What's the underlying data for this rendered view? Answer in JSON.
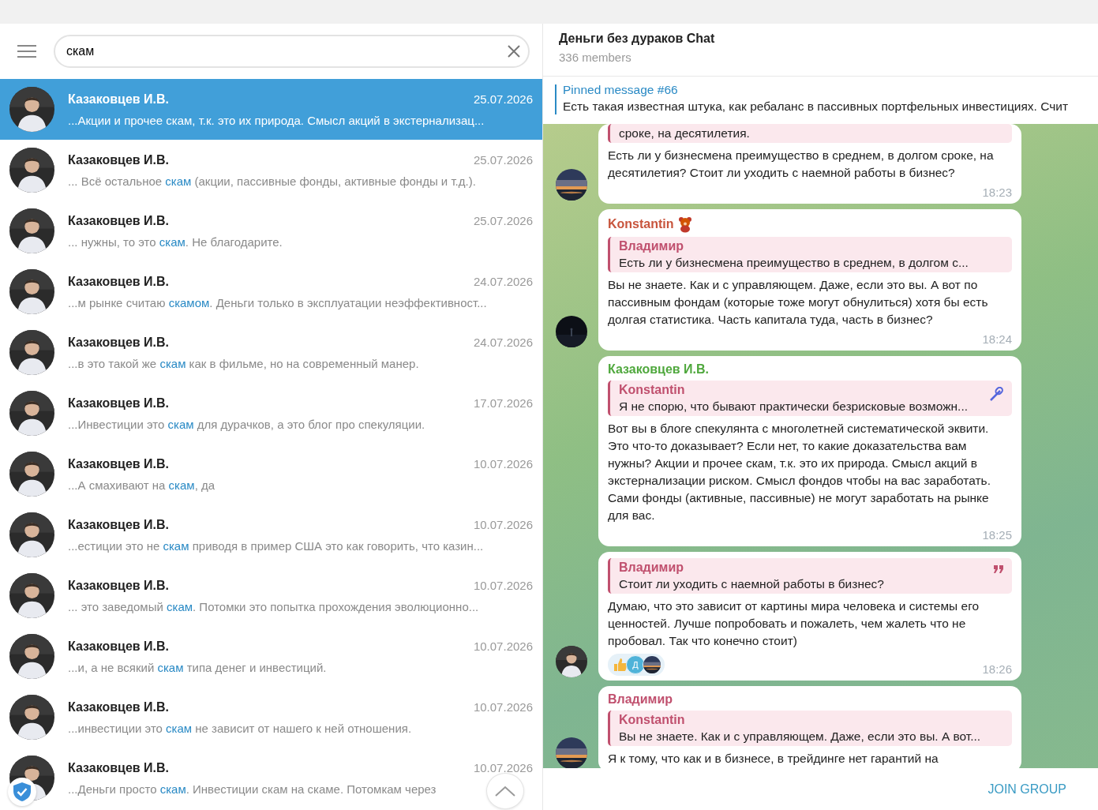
{
  "search": {
    "value": "скам"
  },
  "results": [
    {
      "name": "Казаковцев И.В.",
      "date": "25.07.2026",
      "before": "...Акции и прочее ",
      "match": "скам",
      "after": ", т.к. это их природа. Смысл акций в экстернализац...",
      "selected": true
    },
    {
      "name": "Казаковцев И.В.",
      "date": "25.07.2026",
      "before": "... Всё остальное ",
      "match": "скам",
      "after": " (акции, пассивные фонды, активные фонды и т.д.).",
      "selected": false
    },
    {
      "name": "Казаковцев И.В.",
      "date": "25.07.2026",
      "before": "... нужны, то это ",
      "match": "скам",
      "after": ". Не благодарите.",
      "selected": false
    },
    {
      "name": "Казаковцев И.В.",
      "date": "24.07.2026",
      "before": "...м рынке считаю ",
      "match": "скамом",
      "after": ". Деньги только в эксплуатации неэффективност...",
      "selected": false
    },
    {
      "name": "Казаковцев И.В.",
      "date": "24.07.2026",
      "before": "...в это такой же ",
      "match": "скам",
      "after": " как в фильме, но на современный манер.",
      "selected": false
    },
    {
      "name": "Казаковцев И.В.",
      "date": "17.07.2026",
      "before": "...Инвестиции это ",
      "match": "скам",
      "after": " для дурачков, а это блог про спекуляции.",
      "selected": false
    },
    {
      "name": "Казаковцев И.В.",
      "date": "10.07.2026",
      "before": "...А смахивают на ",
      "match": "скам",
      "after": ", да",
      "selected": false
    },
    {
      "name": "Казаковцев И.В.",
      "date": "10.07.2026",
      "before": "...естиции это не ",
      "match": "скам",
      "after": " приводя в пример США это как говорить, что казин...",
      "selected": false
    },
    {
      "name": "Казаковцев И.В.",
      "date": "10.07.2026",
      "before": "... это заведомый ",
      "match": "скам",
      "after": ". Потомки это попытка прохождения эволюционно...",
      "selected": false
    },
    {
      "name": "Казаковцев И.В.",
      "date": "10.07.2026",
      "before": "...и, а не всякий ",
      "match": "скам",
      "after": " типа денег и инвестиций.",
      "selected": false
    },
    {
      "name": "Казаковцев И.В.",
      "date": "10.07.2026",
      "before": "...инвестиции это ",
      "match": "скам",
      "after": " не зависит от нашего к ней отношения.",
      "selected": false
    },
    {
      "name": "Казаковцев И.В.",
      "date": "10.07.2026",
      "before": "...Деньги просто ",
      "match": "скам",
      "after": ". Инвестиции скам на скаме. Потомкам через",
      "selected": false
    }
  ],
  "chat": {
    "title": "Деньги без дураков Chat",
    "subtitle": "336 members"
  },
  "pinned": {
    "label": "Pinned message #66",
    "text": "Есть такая известная штука, как ребаланс в пассивных портфельных инвестициях. Счит"
  },
  "messages": [
    {
      "avatar": {
        "kind": "picture"
      },
      "quote": {
        "text": "сроке, на десятилетия."
      },
      "text": "Есть ли у бизнесмена преимущество в среднем, в долгом сроке, на десятилетия? Стоит ли уходить с наемной работы в бизнес?",
      "time": "18:23"
    },
    {
      "avatar": {
        "kind": "picture"
      },
      "sender": {
        "name": "Konstantin",
        "color": "#c8553d"
      },
      "quote": {
        "author": "Владимир",
        "text": "Есть ли у бизнесмена преимущество в среднем, в долгом с..."
      },
      "text": "Вы не знаете. Как и с управляющем. Даже, если это вы. А вот по пассивным фондам (которые тоже могут обнулиться) хотя бы есть долгая статистика. Часть капитала туда, часть в бизнес?",
      "time": "18:24"
    },
    {
      "sender": {
        "name": "Казаковцев И.В.",
        "color": "#4fa83d"
      },
      "quote": {
        "author": "Konstantin",
        "text": "Я не спорю, что бывают практически безрисковые возможн..."
      },
      "text": "Вот вы в блоге спекулянта с многолетней систематической эквити. Это что-то доказывает? Если нет, то какие доказательства вам нужны? Акции и прочее скам, т.к. это их природа. Смысл акций в экстернализации риском. Смысл фондов чтобы на вас заработать. Сами фонды (активные, пассивные) не могут заработать на рынке для вас.",
      "time": "18:25"
    },
    {
      "avatar": {
        "kind": "picture"
      },
      "quote": {
        "author": "Владимир",
        "text": "Стоит ли уходить с наемной работы в бизнес?"
      },
      "text": "Думаю, что это зависит от картины мира человека и системы его ценностей. Лучше попробовать и пожалеть, чем жалеть что не пробовал. Так что конечно стоит)",
      "reactions": [
        {
          "kind": "letter",
          "text": "Д",
          "color": "#4fb3d9"
        },
        {
          "kind": "picture"
        }
      ],
      "time": "18:26"
    },
    {
      "avatar": {
        "kind": "picture"
      },
      "sender": {
        "name": "Владимир",
        "color": "#c0506e"
      },
      "quote": {
        "author": "Konstantin",
        "text": "Вы не знаете. Как и с управляющем. Даже, если это вы. А вот..."
      },
      "text": "Я к тому, что как и в бизнесе, в трейдинге нет гарантий на"
    }
  ],
  "footer": {
    "action": "JOIN GROUP"
  }
}
